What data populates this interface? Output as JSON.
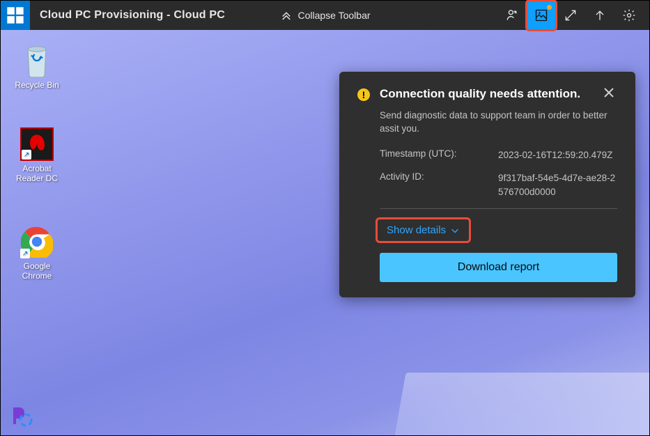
{
  "toolbar": {
    "title": "Cloud PC Provisioning - Cloud PC",
    "collapse_label": "Collapse Toolbar"
  },
  "desktop_icons": {
    "recycle": "Recycle Bin",
    "acrobat": "Acrobat Reader DC",
    "chrome": "Google Chrome"
  },
  "panel": {
    "title": "Connection quality needs attention.",
    "description": "Send diagnostic data to support team in order to better assit you.",
    "timestamp_label": "Timestamp (UTC):",
    "timestamp_value": "2023-02-16T12:59:20.479Z",
    "activity_label": "Activity ID:",
    "activity_value": "9f317baf-54e5-4d7e-ae28-2576700d0000",
    "show_details": "Show details",
    "download": "Download report"
  }
}
